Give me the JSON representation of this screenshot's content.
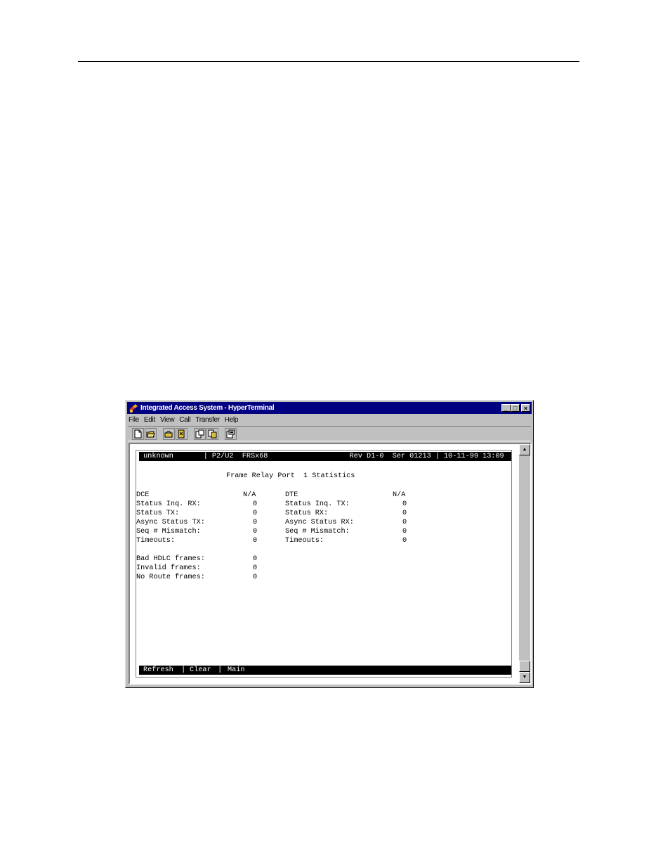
{
  "window": {
    "title": "Integrated Access System - HyperTerminal",
    "controls": {
      "minimize": "_",
      "maximize": "□",
      "close": "×"
    }
  },
  "menu": [
    "File",
    "Edit",
    "View",
    "Call",
    "Transfer",
    "Help"
  ],
  "toolbar": {
    "icons": [
      "new-document-icon",
      "open-folder-icon",
      "connect-icon",
      "disconnect-icon",
      "send-icon",
      "receive-icon",
      "properties-icon"
    ]
  },
  "terminal": {
    "status_line": " unknown       | P2/U2  FRSx68                   Rev D1-0  Ser 01213 | 10-11-99 13:09",
    "heading": "Frame Relay Port  1 Statistics",
    "dce": {
      "label": "DCE",
      "value": "N/A",
      "rows": [
        {
          "label": "Status Inq. RX:",
          "value": "0"
        },
        {
          "label": "Status TX:",
          "value": "0"
        },
        {
          "label": "Async Status TX:",
          "value": "0"
        },
        {
          "label": "Seq # Mismatch:",
          "value": "0"
        },
        {
          "label": "Timeouts:",
          "value": "0"
        }
      ]
    },
    "dte": {
      "label": "DTE",
      "value": "N/A",
      "rows": [
        {
          "label": "Status Inq. TX:",
          "value": "0"
        },
        {
          "label": "Status RX:",
          "value": "0"
        },
        {
          "label": "Async Status RX:",
          "value": "0"
        },
        {
          "label": "Seq # Mismatch:",
          "value": "0"
        },
        {
          "label": "Timeouts:",
          "value": "0"
        }
      ]
    },
    "frames": [
      {
        "label": "Bad HDLC frames:",
        "value": "0"
      },
      {
        "label": "Invalid frames:",
        "value": "0"
      },
      {
        "label": "No Route frames:",
        "value": "0"
      }
    ],
    "commands": [
      "Refresh",
      "Clear",
      "Main"
    ],
    "command_separator": " | "
  },
  "scrollbar": {
    "up": "▲",
    "down": "▼"
  }
}
